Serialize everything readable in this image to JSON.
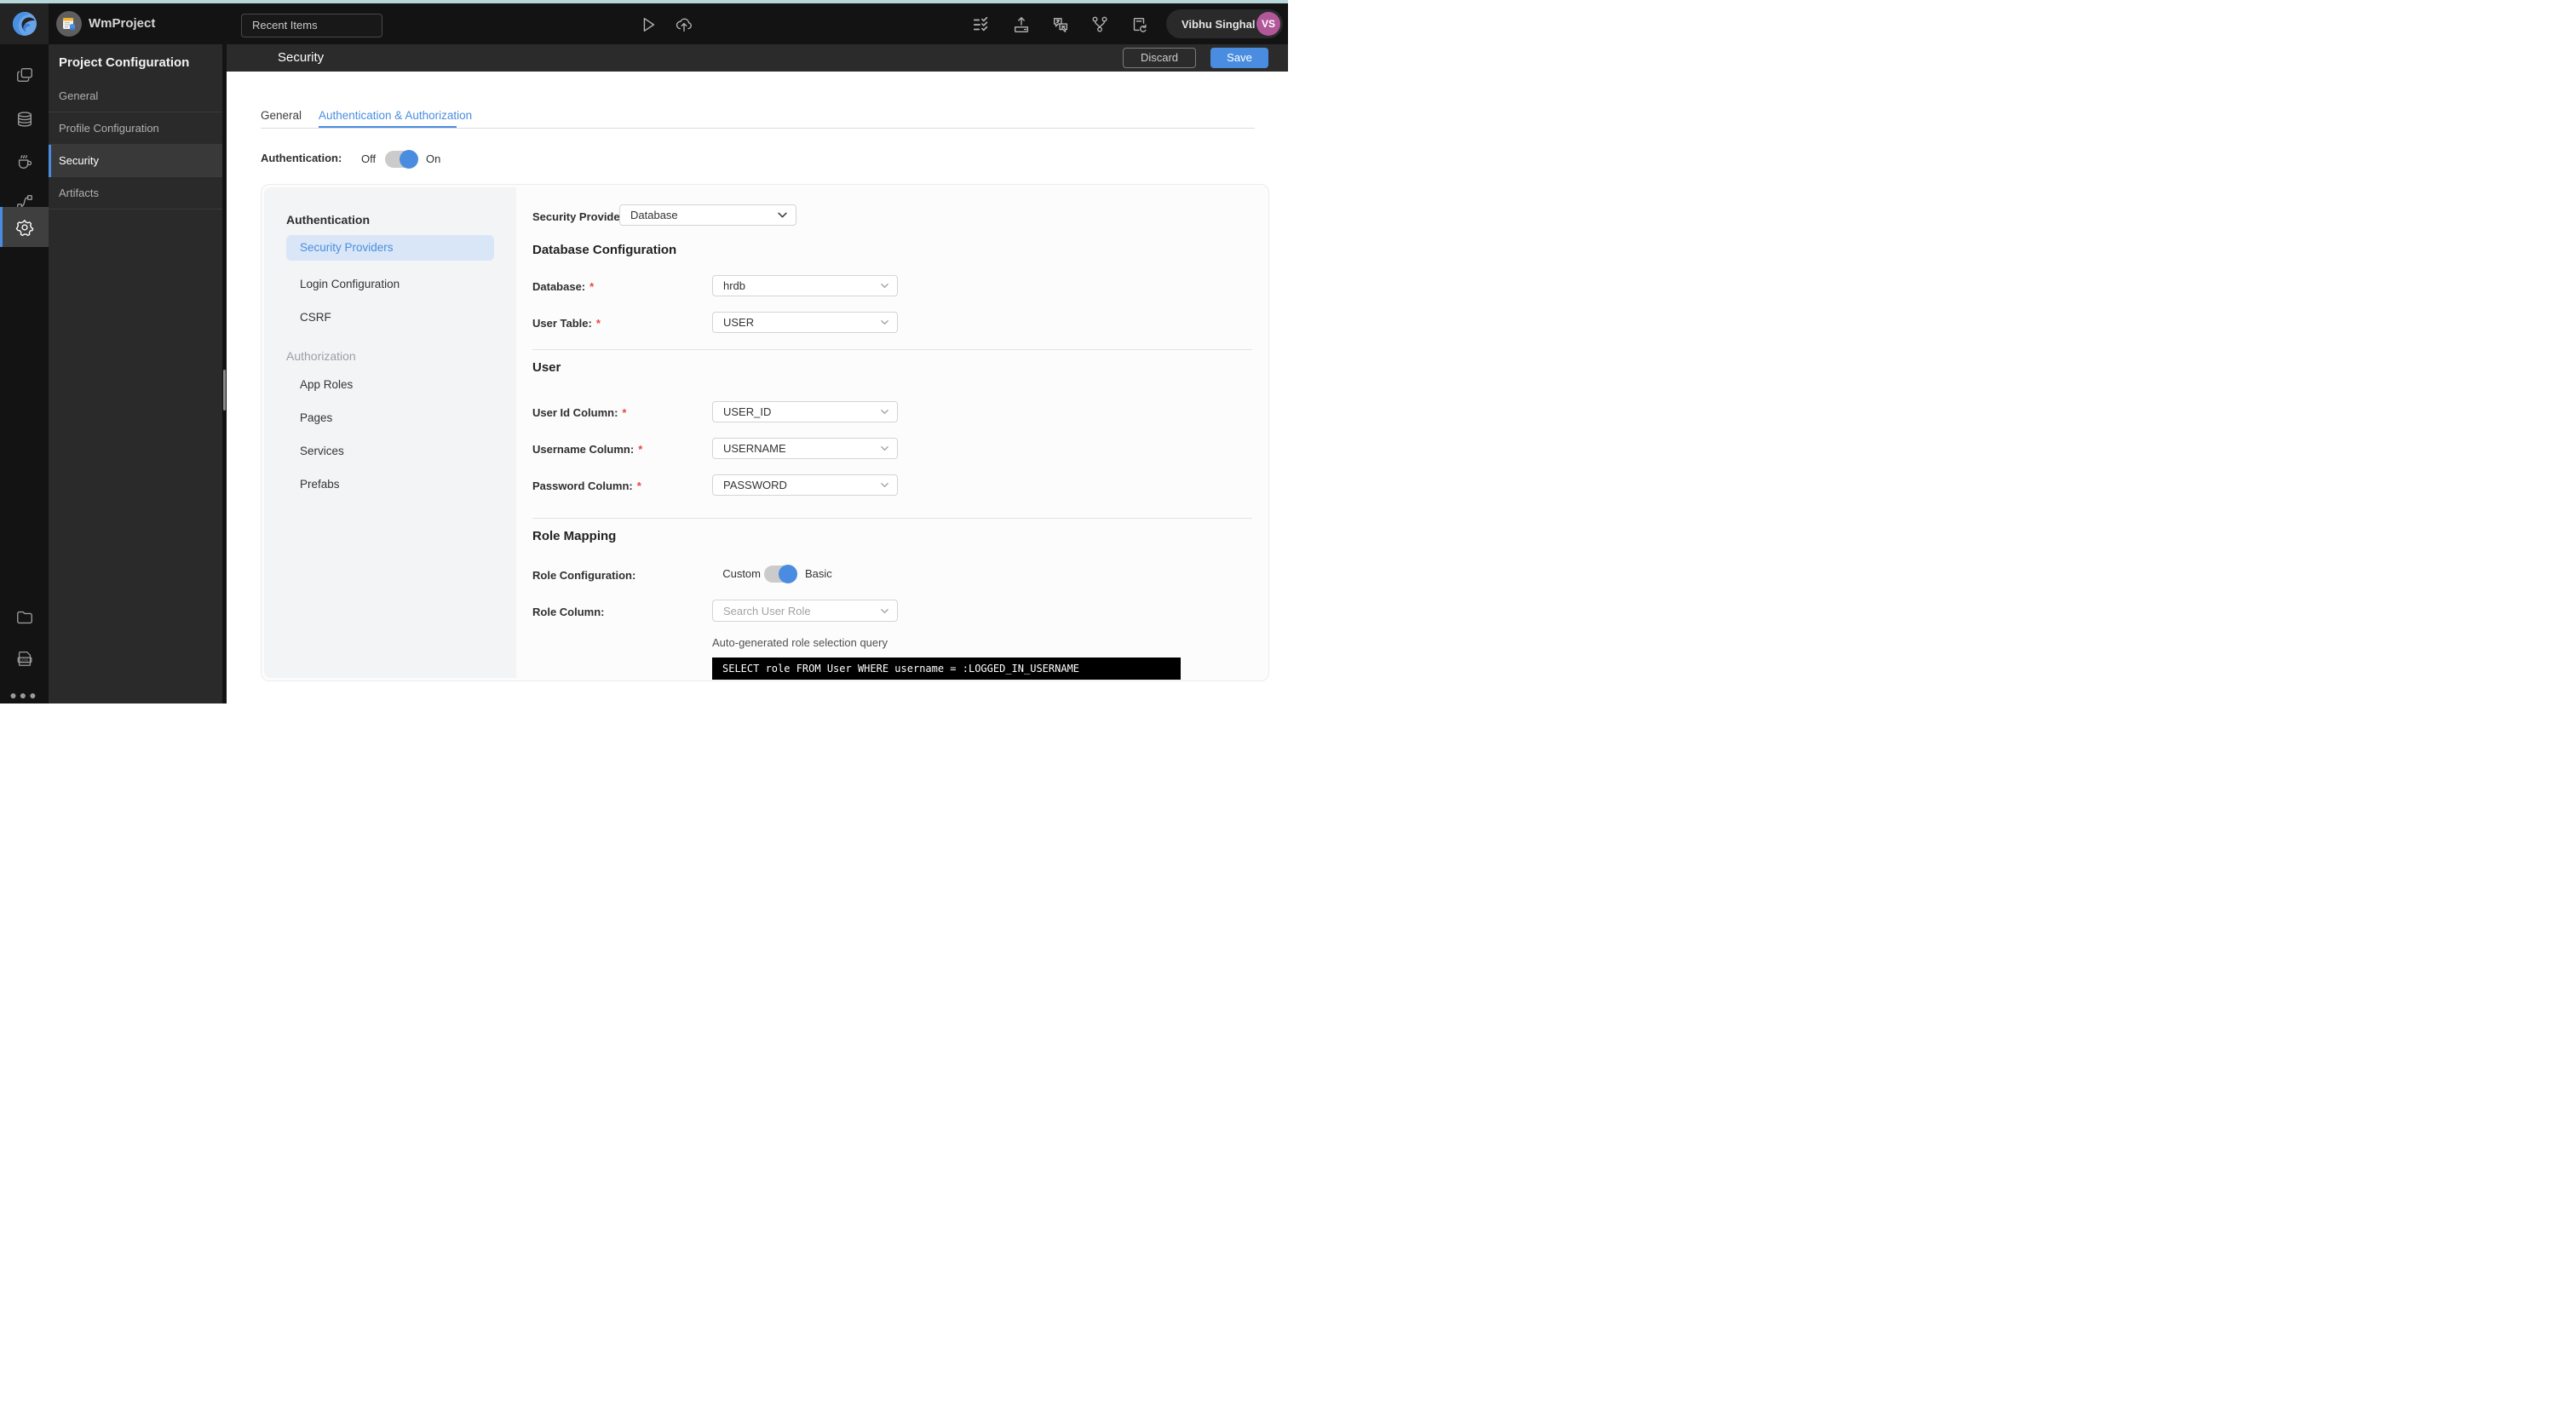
{
  "topbar": {
    "project_name": "WmProject",
    "recent_items_label": "Recent Items",
    "user": {
      "name": "Vibhu Singhal",
      "initials": "VS",
      "avatar_color": "#b2579a"
    }
  },
  "menu": {
    "title": "Project Configuration",
    "items": [
      {
        "label": "General",
        "active": false
      },
      {
        "label": "Profile Configuration",
        "active": false
      },
      {
        "label": "Security",
        "active": true
      },
      {
        "label": "Artifacts",
        "active": false
      }
    ]
  },
  "header": {
    "title": "Security",
    "discard_label": "Discard",
    "save_label": "Save"
  },
  "tabs": [
    {
      "label": "General",
      "active": false
    },
    {
      "label": "Authentication & Authorization",
      "active": true
    }
  ],
  "auth_toggle": {
    "label": "Authentication:",
    "off": "Off",
    "on": "On",
    "state": "on"
  },
  "nav": {
    "sections": [
      {
        "label": "Authentication",
        "items": [
          {
            "label": "Security Providers",
            "selected": true
          },
          {
            "label": "Login Configuration",
            "selected": false
          },
          {
            "label": "CSRF",
            "selected": false
          }
        ]
      },
      {
        "label": "Authorization",
        "items": [
          {
            "label": "App Roles",
            "selected": false
          },
          {
            "label": "Pages",
            "selected": false
          },
          {
            "label": "Services",
            "selected": false
          },
          {
            "label": "Prefabs",
            "selected": false
          }
        ]
      }
    ]
  },
  "form": {
    "security_provider": {
      "label": "Security Provider",
      "value": "Database"
    },
    "database_section": {
      "heading": "Database Configuration",
      "database": {
        "label": "Database:",
        "required": "*",
        "value": "hrdb"
      },
      "user_table": {
        "label": "User Table:",
        "required": "*",
        "value": "USER"
      }
    },
    "user_section": {
      "heading": "User",
      "user_id": {
        "label": "User Id Column:",
        "required": "*",
        "value": "USER_ID"
      },
      "username": {
        "label": "Username Column:",
        "required": "*",
        "value": "USERNAME"
      },
      "password": {
        "label": "Password Column:",
        "required": "*",
        "value": "PASSWORD"
      }
    },
    "role_mapping": {
      "heading": "Role Mapping",
      "role_configuration": {
        "label": "Role Configuration:",
        "left": "Custom",
        "right": "Basic",
        "state": "basic"
      },
      "role_column": {
        "label": "Role Column:",
        "placeholder": "Search User Role"
      },
      "query_caption": "Auto-generated role selection query",
      "query": "SELECT role FROM User WHERE username = :LOGGED_IN_USERNAME"
    }
  },
  "colors": {
    "accent": "#4a8de0",
    "nav_selected_bg": "#d9e6f7",
    "required": "#e8483f",
    "topbar_bg": "#131313"
  }
}
